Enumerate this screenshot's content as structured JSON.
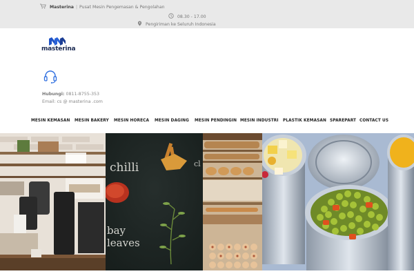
{
  "topbar": {
    "brand": "Masterina",
    "tagline": "Pusat Mesin Pengemasan & Pengolahan",
    "hours": "08.30 - 17.00",
    "shipping": "Pengiriman ke Seluruh Indonesia",
    "icons": {
      "cart": "cart-icon",
      "clock": "clock-icon",
      "location": "location-pin-icon"
    }
  },
  "logo": {
    "text": "masterina",
    "mark_color": "#1f53c6"
  },
  "contact": {
    "phone_label": "Hubungi:",
    "phone": "0811-8755-353",
    "email": "Email: cs @ masterina .com",
    "icon": "headset-icon",
    "icon_color": "#2f6fe0"
  },
  "nav": {
    "items": [
      {
        "label": "MESIN KEMASAN"
      },
      {
        "label": "MESIN BAKERY"
      },
      {
        "label": "MESIN HORECA"
      },
      {
        "label": "MESIN DAGING"
      },
      {
        "label": "MESIN PENDINGIN"
      },
      {
        "label": "MESIN INDUSTRI"
      },
      {
        "label": "PLASTIK KEMASAN"
      },
      {
        "label": "SPAREPART"
      },
      {
        "label": "CONTACT US"
      }
    ]
  },
  "hero": {
    "chalkboard_words": [
      "chilli",
      "bay",
      "leaves",
      "cl"
    ]
  },
  "colors": {
    "topbar_bg": "#e9e9e9",
    "accent": "#2f6fe0",
    "nav_text": "#222222"
  }
}
